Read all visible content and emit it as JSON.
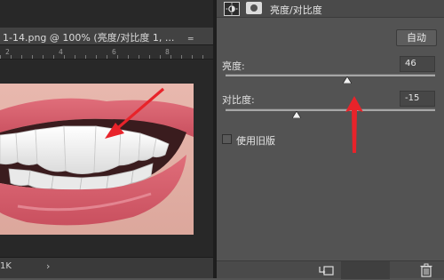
{
  "document": {
    "tab_label": "1-14.png @ 100% (亮度/对比度 1, ...",
    "minimize_glyph": "‗",
    "close_glyph": "▭",
    "ruler_numbers": [
      "2",
      "4",
      "6",
      "8"
    ],
    "status_zoom": "1K",
    "status_arrow": "›"
  },
  "panel": {
    "title": "亮度/对比度",
    "auto_button": "自动",
    "brightness": {
      "label": "亮度:",
      "value": "46",
      "level": 0.58
    },
    "contrast": {
      "label": "对比度:",
      "value": "-15",
      "level": 0.34
    },
    "legacy_checkbox": {
      "label": "使用旧版",
      "checked": false
    }
  },
  "annotation_colors": {
    "arrow": "#e8232a"
  }
}
